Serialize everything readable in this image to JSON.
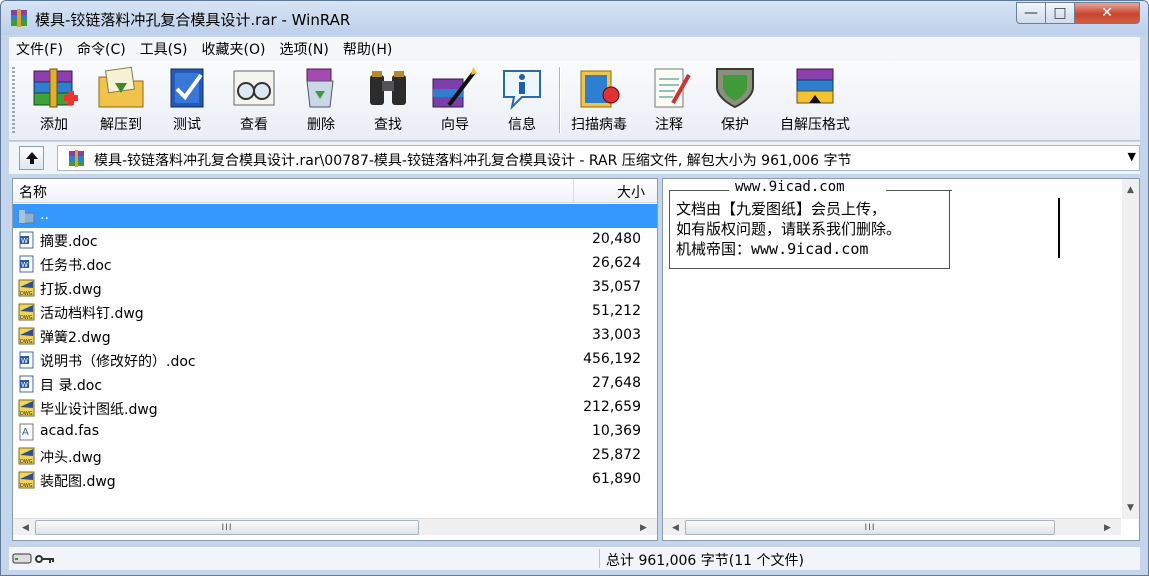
{
  "window": {
    "title": "模具-铰链落料冲孔复合模具设计.rar - WinRAR",
    "minimize": "—",
    "maximize": "□",
    "close": "✕"
  },
  "menu": [
    "文件(F)",
    "命令(C)",
    "工具(S)",
    "收藏夹(O)",
    "选项(N)",
    "帮助(H)"
  ],
  "toolbar": {
    "add": "添加",
    "extract": "解压到",
    "test": "测试",
    "view": "查看",
    "delete": "删除",
    "find": "查找",
    "wizard": "向导",
    "info": "信息",
    "virus_scan": "扫描病毒",
    "comment": "注释",
    "protect": "保护",
    "sfx": "自解压格式"
  },
  "address": {
    "path": "模具-铰链落料冲孔复合模具设计.rar\\00787-模具-铰链落料冲孔复合模具设计 - RAR 压缩文件, 解包大小为 961,006 字节"
  },
  "filelist": {
    "col_name": "名称",
    "col_size": "大小",
    "rows": [
      {
        "name": "..",
        "size": "",
        "type": "folder",
        "selected": true
      },
      {
        "name": "摘要.doc",
        "size": "20,480",
        "type": "doc"
      },
      {
        "name": "任务书.doc",
        "size": "26,624",
        "type": "doc"
      },
      {
        "name": "打扳.dwg",
        "size": "35,057",
        "type": "dwg"
      },
      {
        "name": "活动档料钉.dwg",
        "size": "51,212",
        "type": "dwg"
      },
      {
        "name": "弹簧2.dwg",
        "size": "33,003",
        "type": "dwg"
      },
      {
        "name": "说明书（修改好的）.doc",
        "size": "456,192",
        "type": "doc"
      },
      {
        "name": "目  录.doc",
        "size": "27,648",
        "type": "doc"
      },
      {
        "name": "毕业设计图纸.dwg",
        "size": "212,659",
        "type": "dwg"
      },
      {
        "name": "acad.fas",
        "size": "10,369",
        "type": "fas"
      },
      {
        "name": "冲头.dwg",
        "size": "25,872",
        "type": "dwg"
      },
      {
        "name": "装配图.dwg",
        "size": "61,890",
        "type": "dwg"
      }
    ]
  },
  "comment": {
    "title": "www.9icad.com",
    "line1": "文档由【九爱图纸】会员上传，",
    "line2": "如有版权问题，请联系我们删除。",
    "line3": "机械帝国：www.9icad.com"
  },
  "scroll": {
    "grip": "III",
    "left": "◀",
    "right": "▶",
    "up": "▲",
    "down": "▼"
  },
  "status": {
    "summary": "总计 961,006 字节(11 个文件)"
  },
  "colors": {
    "selection": "#3399ff",
    "frame": "#c4d5ec",
    "close_button": "#c7452f"
  }
}
